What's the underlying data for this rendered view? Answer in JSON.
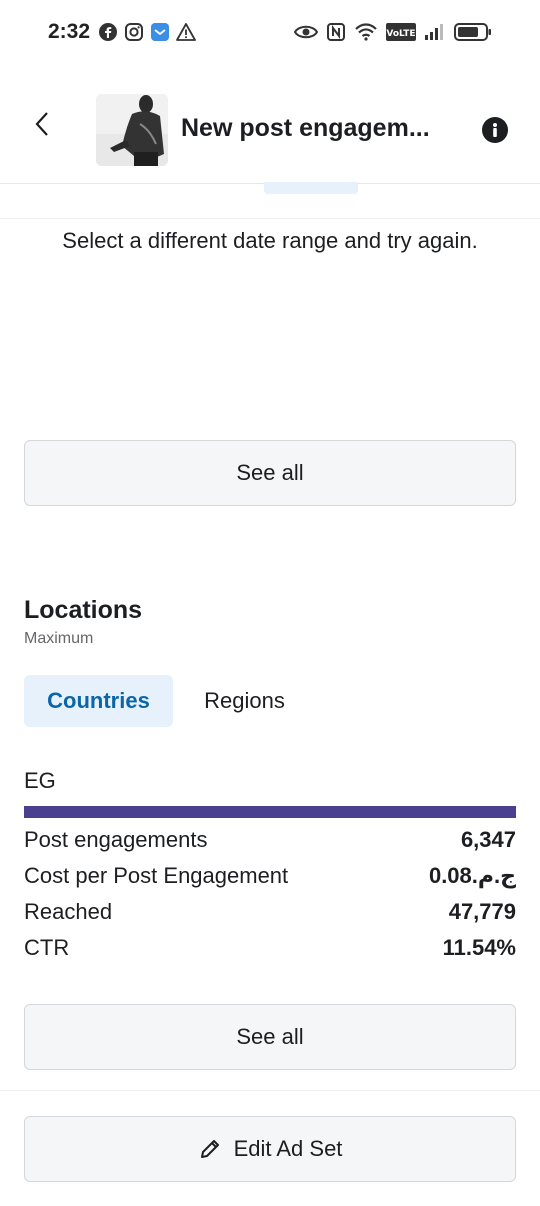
{
  "status_bar": {
    "time": "2:32",
    "volte": "VoLTE",
    "icons_left": [
      "facebook-icon",
      "instagram-icon",
      "app-notification-icon",
      "warning-icon"
    ],
    "icons_right": [
      "eye-icon",
      "nfc-icon",
      "wifi-icon",
      "volte-icon",
      "signal-icon",
      "battery-icon"
    ]
  },
  "header": {
    "title": "New post engagem...",
    "back_icon": "chevron-left-icon",
    "info_icon": "info-icon"
  },
  "empty_state": {
    "message": "Select a different date range and try again."
  },
  "see_all_top": {
    "label": "See all"
  },
  "locations": {
    "title": "Locations",
    "subtitle": "Maximum",
    "tabs": [
      {
        "label": "Countries",
        "active": true
      },
      {
        "label": "Regions",
        "active": false
      }
    ],
    "country": "EG",
    "bar_fill_fraction": 1.0,
    "bar_color": "#4b3f8f",
    "metrics": [
      {
        "label": "Post engagements",
        "value": "6,347"
      },
      {
        "label": "Cost per Post Engagement",
        "value": "ج.م.‏0.08"
      },
      {
        "label": "Reached",
        "value": "47,779"
      },
      {
        "label": "CTR",
        "value": "11.54%"
      }
    ]
  },
  "see_all_bottom": {
    "label": "See all"
  },
  "edit_button": {
    "label": "Edit Ad Set",
    "icon": "pencil-icon"
  },
  "colors": {
    "accent": "#0a66a8",
    "tab_active_bg": "#e7f1fb",
    "button_bg": "#f5f6f7"
  }
}
